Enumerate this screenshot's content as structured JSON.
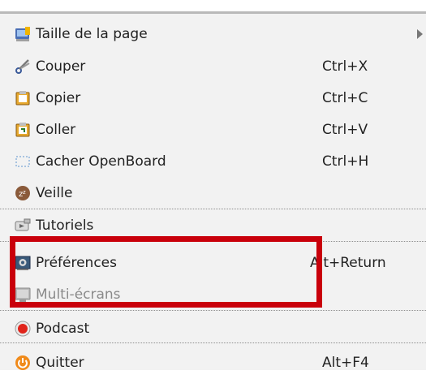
{
  "menu": {
    "items": [
      {
        "label": "Taille de la page",
        "shortcut": "",
        "icon": "page-size-icon",
        "has_submenu": true
      },
      {
        "label": "Couper",
        "shortcut": "Ctrl+X",
        "icon": "scissors-icon"
      },
      {
        "label": "Copier",
        "shortcut": "Ctrl+C",
        "icon": "copy-icon"
      },
      {
        "label": "Coller",
        "shortcut": "Ctrl+V",
        "icon": "paste-icon"
      },
      {
        "label": "Cacher OpenBoard",
        "shortcut": "Ctrl+H",
        "icon": "hide-icon"
      },
      {
        "label": "Veille",
        "shortcut": "",
        "icon": "sleep-icon"
      },
      {
        "label": "Tutoriels",
        "shortcut": "",
        "icon": "tutorial-icon"
      },
      {
        "label": "Préférences",
        "shortcut": "Alt+Return",
        "icon": "preferences-icon"
      },
      {
        "label": "Multi-écrans",
        "shortcut": "",
        "icon": "multiscreen-icon",
        "disabled": true
      },
      {
        "label": "Podcast",
        "shortcut": "",
        "icon": "podcast-icon"
      },
      {
        "label": "Quitter",
        "shortcut": "Alt+F4",
        "icon": "power-icon"
      }
    ]
  },
  "colors": {
    "highlight_border": "#c9000b",
    "menu_background": "#f2f2f2",
    "text": "#222222",
    "disabled_text": "#8a8a8a"
  }
}
